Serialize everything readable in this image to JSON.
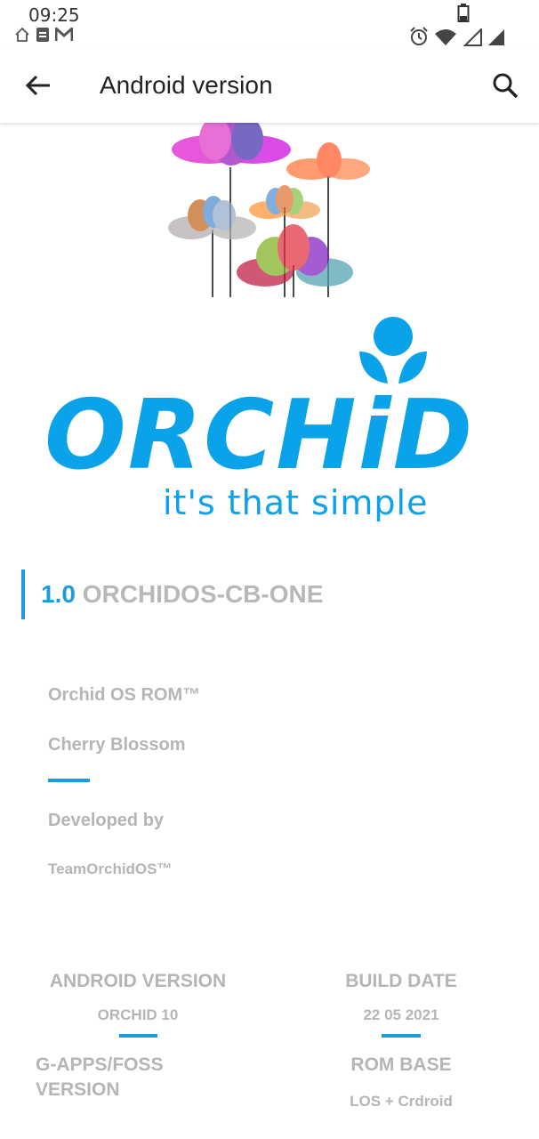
{
  "status_bar": {
    "time": "09:25",
    "notification_icons": [
      "home-icon",
      "note-icon",
      "gmail-icon"
    ],
    "system_icons": [
      "battery-icon",
      "alarm-icon",
      "wifi-icon",
      "signal-icon"
    ]
  },
  "app_bar": {
    "title": "Android version",
    "back_icon": "arrow-left-icon",
    "search_icon": "search-icon"
  },
  "logo": {
    "wordmark": "ORCHiD",
    "tagline": "it's that simple",
    "brand_color": "#0aa3ea"
  },
  "version": {
    "number": "1.0",
    "name": "ORCHIDOS-CB-ONE"
  },
  "info": {
    "rom_name": "Orchid OS ROM™",
    "codename": "Cherry Blossom",
    "developed_label": "Developed by",
    "developer": "TeamOrchidOS™"
  },
  "details": {
    "android_version_label": "ANDROID VERSION",
    "android_version_value": "ORCHID 10",
    "build_date_label": "BUILD DATE",
    "build_date_value": "22 05 2021",
    "gapps_label_line1": "G-APPS/FOSS",
    "gapps_label_line2": "VERSION",
    "rom_base_label": "ROM BASE",
    "rom_base_value": "LOS + Crdroid"
  }
}
